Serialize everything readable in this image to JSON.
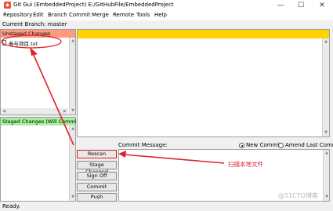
{
  "window": {
    "title": "Git Gui (EmbeddedProject) E:/GitHubFile/EmbeddedProject",
    "app_icon": "git-logo",
    "controls": [
      "—",
      "☐",
      "✕"
    ]
  },
  "menu": [
    "Repository",
    "Edit",
    "Branch",
    "Commit",
    "Merge",
    "Remote",
    "Tools",
    "Help"
  ],
  "branch_label": "Current Branch: master",
  "unstaged": {
    "header": "Unstaged Changes",
    "files": [
      {
        "name": "参与项目.txt",
        "icon": "file-icon"
      }
    ]
  },
  "staged": {
    "header": "Staged Changes (Will Commit)"
  },
  "buttons": {
    "rescan": "Rescan",
    "stage_changed": "Stage Changed",
    "sign_off": "Sign Off",
    "commit": "Commit",
    "push": "Push"
  },
  "commit_area": {
    "label": "Commit Message:",
    "new_commit": "New Commit",
    "amend": "Amend Last Commit",
    "selected": "new_commit"
  },
  "status": "Ready.",
  "annotation": {
    "text": "扫描本地文件",
    "color": "#e0202a"
  },
  "watermark": "@51CTO博客"
}
